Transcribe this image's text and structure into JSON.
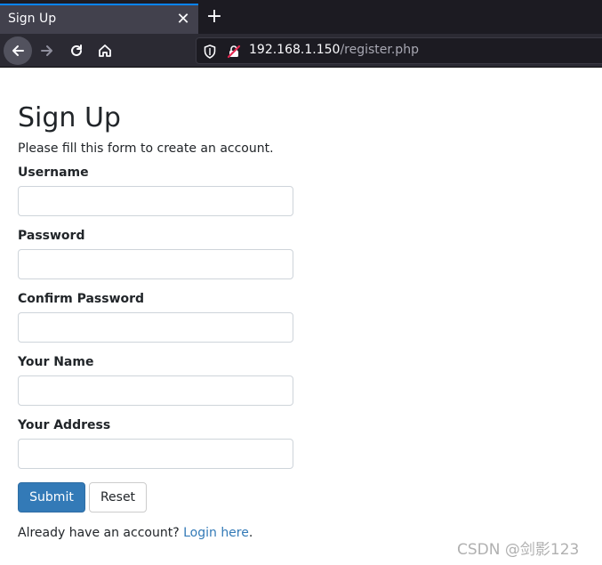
{
  "browser": {
    "tab_title": "Sign Up",
    "tab_close_icon": "close-icon",
    "new_tab_icon": "plus-icon",
    "url_host": "192.168.1.150",
    "url_path": "/register.php",
    "nav_icons": [
      "back-arrow-icon",
      "forward-arrow-icon",
      "reload-icon",
      "home-icon"
    ],
    "accent_color": "#0a84ff"
  },
  "page": {
    "title": "Sign Up",
    "subtitle": "Please fill this form to create an account.",
    "fields": [
      {
        "label": "Username",
        "value": ""
      },
      {
        "label": "Password",
        "value": ""
      },
      {
        "label": "Confirm Password",
        "value": ""
      },
      {
        "label": "Your Name",
        "value": ""
      },
      {
        "label": "Your Address",
        "value": ""
      }
    ],
    "submit_label": "Submit",
    "reset_label": "Reset",
    "login_prompt": "Already have an account?",
    "login_link": "Login here",
    "login_suffix": ".",
    "primary_color": "#337ab7"
  },
  "watermark": "CSDN @剑影123"
}
